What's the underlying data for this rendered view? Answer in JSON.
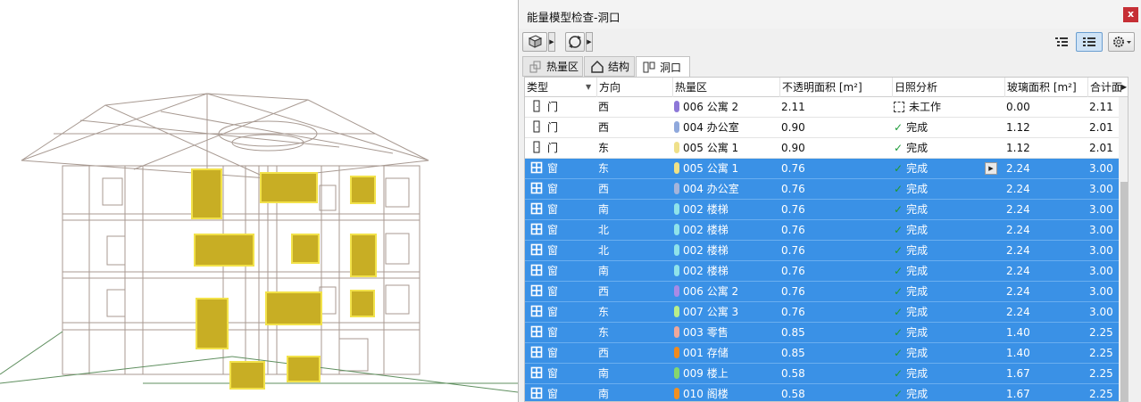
{
  "window": {
    "title": "能量模型检查-洞口",
    "close_label": "x"
  },
  "toolbar": {
    "left_buttons": [
      "cube-icon",
      "refresh-icon"
    ],
    "right_buttons": [
      "list-detail-icon",
      "list-icon",
      "gear-icon"
    ]
  },
  "tabs": [
    {
      "label": "热量区",
      "icon": "thermal-zone-icon",
      "active": false
    },
    {
      "label": "结构",
      "icon": "house-icon",
      "active": false
    },
    {
      "label": "洞口",
      "icon": "door-window-icon",
      "active": true
    }
  ],
  "table": {
    "columns": [
      "类型",
      "方向",
      "热量区",
      "不透明面积 [m²]",
      "日照分析",
      "玻璃面积 [m²]",
      "合计面"
    ],
    "rows": [
      {
        "type": "门",
        "icon": "door-icon",
        "orient": "西",
        "zone": "006 公寓 2",
        "zone_color": "#8d78d8",
        "opaque": "2.11",
        "sun": "未工作",
        "sun_state": "idle",
        "glass": "0.00",
        "total": "2.11",
        "selected": false
      },
      {
        "type": "门",
        "icon": "door-icon",
        "orient": "西",
        "zone": "004 办公室",
        "zone_color": "#8fa8dc",
        "opaque": "0.90",
        "sun": "完成",
        "sun_state": "done",
        "glass": "1.12",
        "total": "2.01",
        "selected": false
      },
      {
        "type": "门",
        "icon": "door-icon",
        "orient": "东",
        "zone": "005 公寓 1",
        "zone_color": "#efe08a",
        "opaque": "0.90",
        "sun": "完成",
        "sun_state": "done",
        "glass": "1.12",
        "total": "2.01",
        "selected": false
      },
      {
        "type": "窗",
        "icon": "window-icon",
        "orient": "东",
        "zone": "005 公寓 1",
        "zone_color": "#f1e285",
        "opaque": "0.76",
        "sun": "完成",
        "sun_state": "done",
        "glass": "2.24",
        "total": "3.00",
        "selected": true
      },
      {
        "type": "窗",
        "icon": "window-icon",
        "orient": "西",
        "zone": "004 办公室",
        "zone_color": "#a5b4da",
        "opaque": "0.76",
        "sun": "完成",
        "sun_state": "done",
        "glass": "2.24",
        "total": "3.00",
        "selected": true
      },
      {
        "type": "窗",
        "icon": "window-icon",
        "orient": "南",
        "zone": "002 楼梯",
        "zone_color": "#8fe3ea",
        "opaque": "0.76",
        "sun": "完成",
        "sun_state": "done",
        "glass": "2.24",
        "total": "3.00",
        "selected": true
      },
      {
        "type": "窗",
        "icon": "window-icon",
        "orient": "北",
        "zone": "002 楼梯",
        "zone_color": "#8fe3ea",
        "opaque": "0.76",
        "sun": "完成",
        "sun_state": "done",
        "glass": "2.24",
        "total": "3.00",
        "selected": true
      },
      {
        "type": "窗",
        "icon": "window-icon",
        "orient": "北",
        "zone": "002 楼梯",
        "zone_color": "#8fe3ea",
        "opaque": "0.76",
        "sun": "完成",
        "sun_state": "done",
        "glass": "2.24",
        "total": "3.00",
        "selected": true
      },
      {
        "type": "窗",
        "icon": "window-icon",
        "orient": "南",
        "zone": "002 楼梯",
        "zone_color": "#8fe3ea",
        "opaque": "0.76",
        "sun": "完成",
        "sun_state": "done",
        "glass": "2.24",
        "total": "3.00",
        "selected": true
      },
      {
        "type": "窗",
        "icon": "window-icon",
        "orient": "西",
        "zone": "006 公寓 2",
        "zone_color": "#a98ae6",
        "opaque": "0.76",
        "sun": "完成",
        "sun_state": "done",
        "glass": "2.24",
        "total": "3.00",
        "selected": true
      },
      {
        "type": "窗",
        "icon": "window-icon",
        "orient": "东",
        "zone": "007 公寓 3",
        "zone_color": "#b9ee8a",
        "opaque": "0.76",
        "sun": "完成",
        "sun_state": "done",
        "glass": "2.24",
        "total": "3.00",
        "selected": true
      },
      {
        "type": "窗",
        "icon": "window-icon",
        "orient": "东",
        "zone": "003 零售",
        "zone_color": "#f0a89a",
        "opaque": "0.85",
        "sun": "完成",
        "sun_state": "done",
        "glass": "1.40",
        "total": "2.25",
        "selected": true
      },
      {
        "type": "窗",
        "icon": "window-icon",
        "orient": "西",
        "zone": "001 存储",
        "zone_color": "#f08a1e",
        "opaque": "0.85",
        "sun": "完成",
        "sun_state": "done",
        "glass": "1.40",
        "total": "2.25",
        "selected": true
      },
      {
        "type": "窗",
        "icon": "window-icon",
        "orient": "南",
        "zone": "009  楼上",
        "zone_color": "#86d66e",
        "opaque": "0.58",
        "sun": "完成",
        "sun_state": "done",
        "glass": "1.67",
        "total": "2.25",
        "selected": true
      },
      {
        "type": "窗",
        "icon": "window-icon",
        "orient": "南",
        "zone": "010 阁楼",
        "zone_color": "#f29020",
        "opaque": "0.58",
        "sun": "完成",
        "sun_state": "done",
        "glass": "1.67",
        "total": "2.25",
        "selected": true
      }
    ]
  }
}
